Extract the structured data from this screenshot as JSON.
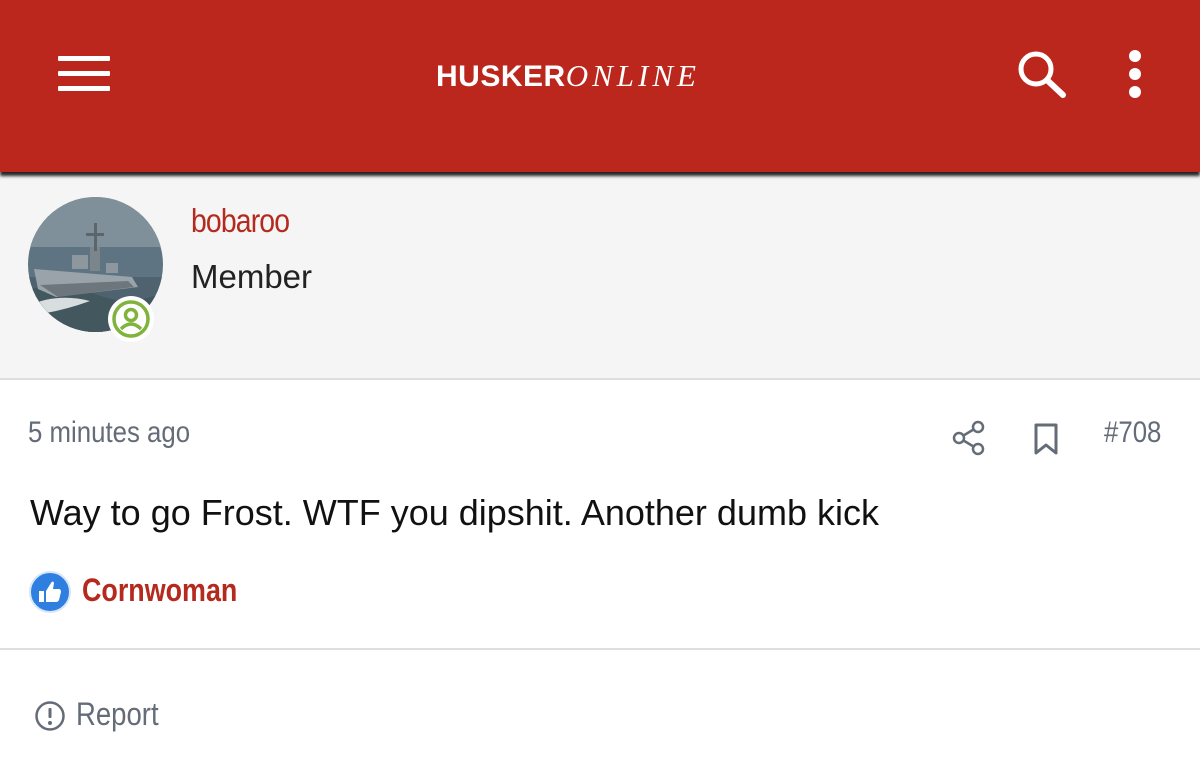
{
  "header": {
    "brand_part1": "HUSKER",
    "brand_part2": "ONLINE",
    "menu_icon": "hamburger-menu-icon",
    "search_icon": "search-icon",
    "more_icon": "vertical-dots-icon",
    "background_color": "#bb271c"
  },
  "author": {
    "username": "bobaroo",
    "title": "Member",
    "avatar_icon": "warship-photo-avatar",
    "status_icon": "online-user-icon",
    "status_color": "#7fb33b"
  },
  "post": {
    "timestamp": "5 minutes ago",
    "number": "#708",
    "body": "Way to go Frost. WTF you dipshit. Another dumb kick",
    "share_icon": "share-icon",
    "bookmark_icon": "bookmark-icon"
  },
  "reactions": {
    "icon": "thumbs-up-icon",
    "icon_color": "#2f7fe0",
    "user": "Cornwoman"
  },
  "footer": {
    "report_label": "Report",
    "report_icon": "exclamation-circle-icon"
  },
  "colors": {
    "accent_red": "#b52a1e",
    "muted_text": "#646c78"
  }
}
